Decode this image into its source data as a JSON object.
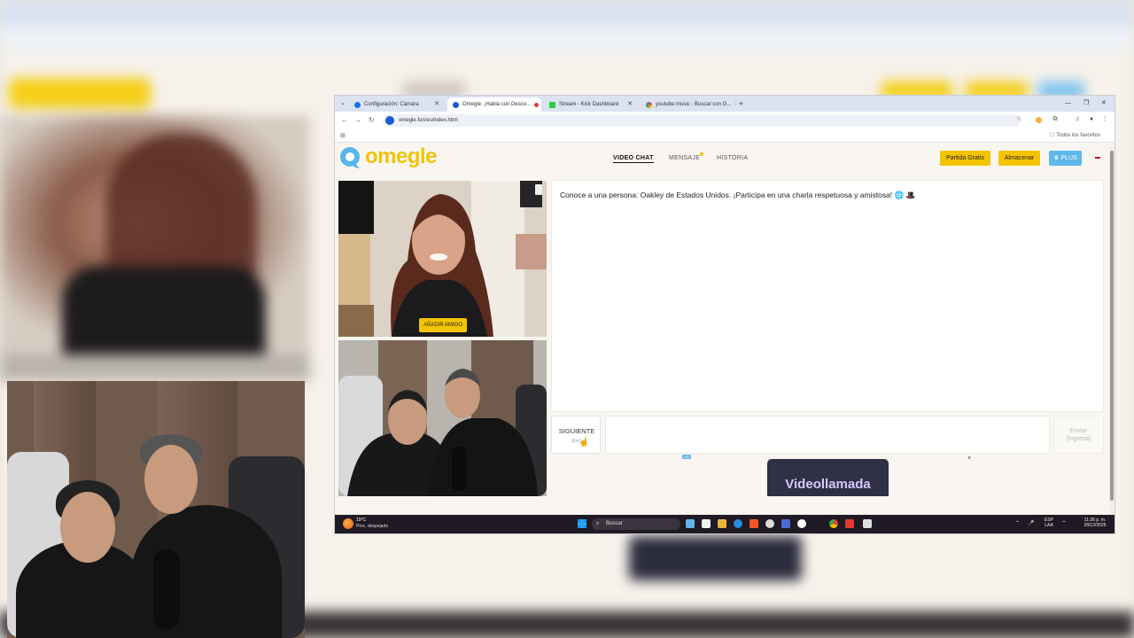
{
  "browser": {
    "tabs": [
      {
        "label": "Configuración: Cámara",
        "icon": "gear-icon",
        "color": "#1a73e8"
      },
      {
        "label": "Omegle: ¡Habla con Desco...",
        "icon": "omegle-icon",
        "color": "#1a5ad7"
      },
      {
        "label": "Stream - Kick Dashboard",
        "icon": "kick-icon",
        "color": "#53fc18"
      },
      {
        "label": "youtube music - Buscar con G...",
        "icon": "google-icon",
        "color": "#4285f4"
      }
    ],
    "url": "omegle.fun/es/index.html",
    "bookmarks_all": "Todos los favoritos"
  },
  "site": {
    "logo": "omegle",
    "nav": [
      "VIDEO CHAT",
      "MENSAJE",
      "HISTORIA"
    ],
    "buttons": {
      "free_game": "Partida Gratis",
      "store": "Almacenar",
      "plus": "PLUS"
    },
    "colors": {
      "accent": "#f5c400",
      "plus": "#5fb8ec"
    }
  },
  "chat": {
    "message": "Conoce a una persona: Oakley de Estados Unidos. ¡Participa en una charla respetuosa y amistosa! 🌐 🎩",
    "add_friend": "AÑADIR AMIGO",
    "next": "SIGUIENTE",
    "next_sub": "(Esc)",
    "input_value": "",
    "send": "Enviar",
    "send_sub": "(Ingresa)"
  },
  "ad": {
    "text": "Videollamada",
    "badge": "AD",
    "close": "×"
  },
  "taskbar": {
    "weather_temp": "19°C",
    "weather_desc": "Prec. despejado",
    "search": "Buscar",
    "lang_top": "ESP",
    "lang_bottom": "LAA",
    "time": "11:36 p. m.",
    "date": "28/12/2025"
  }
}
